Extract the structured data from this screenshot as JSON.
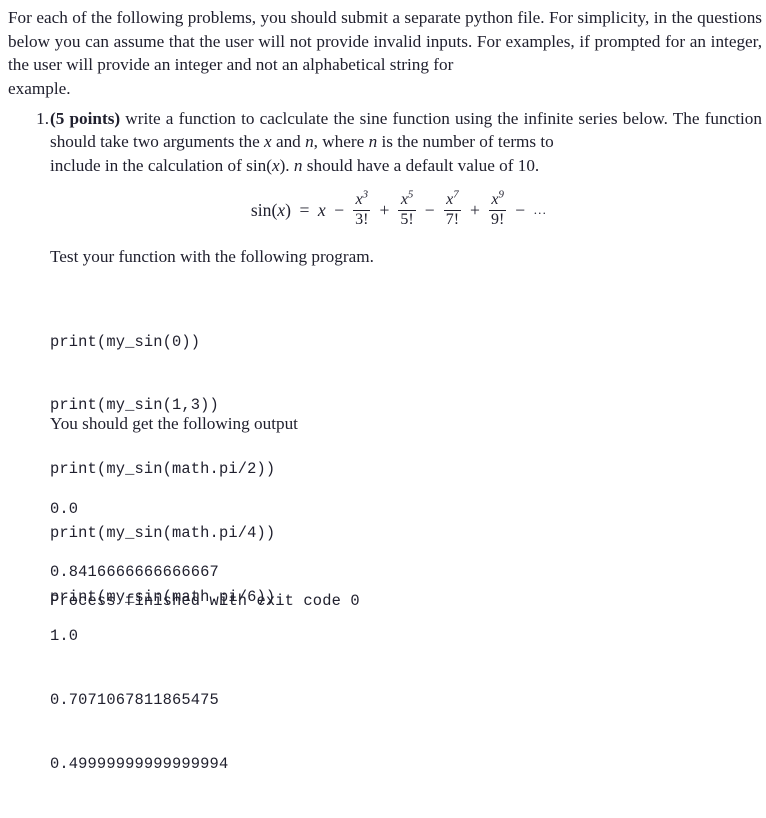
{
  "document": {
    "intro": {
      "lines": [
        "For each of the following problems, you should submit a separate python file. For simplicity, in",
        "the questions below you can assume that the user will not provide invalid inputs. For examples,",
        "if prompted for an integer, the user will provide an integer and not an alphabetical string for",
        "example."
      ]
    },
    "problem": {
      "marker": "1.",
      "points_label": "(5 points)",
      "line1_rest": " write a function to caclculate the sine function using the infinite series below.",
      "line2_a": "The function should take two arguments the ",
      "line2_var1": "x",
      "line2_b": " and ",
      "line2_var2": "n",
      "line2_c": ", where ",
      "line2_var3": "n",
      "line2_d": " is the number of terms to",
      "line3_a": "include in the calculation of sin(",
      "line3_var1": "x",
      "line3_b": "). ",
      "line3_var2": "n",
      "line3_c": " should have a default value of 10."
    },
    "formula": {
      "lhs": "sin(x)",
      "equals": "=",
      "first_term": "x",
      "terms": [
        {
          "sign": "−",
          "numerator_base": "x",
          "numerator_exp": "3",
          "denominator": "3!"
        },
        {
          "sign": "+",
          "numerator_base": "x",
          "numerator_exp": "5",
          "denominator": "5!"
        },
        {
          "sign": "−",
          "numerator_base": "x",
          "numerator_exp": "7",
          "denominator": "7!"
        },
        {
          "sign": "+",
          "numerator_base": "x",
          "numerator_exp": "9",
          "denominator": "9!"
        }
      ],
      "tail_sign": "−",
      "tail_dots": "..."
    },
    "test_prompt": "Test your function with the following program.",
    "program": [
      "print(my_sin(0))",
      "print(my_sin(1,3))",
      "print(my_sin(math.pi/2))",
      "print(my_sin(math.pi/4))",
      "print(my_sin(math.pi/6))"
    ],
    "output_prompt": "You should get the following output",
    "output_values": [
      "0.0",
      "0.8416666666666667",
      "1.0",
      "0.7071067811865475",
      "0.49999999999999994"
    ],
    "exit_message": "Process finished with exit code 0"
  }
}
